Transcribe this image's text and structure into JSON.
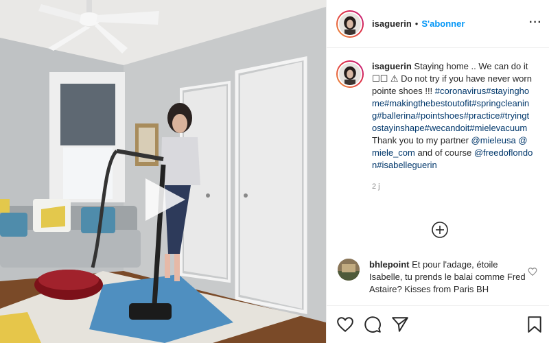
{
  "header": {
    "username": "isaguerin",
    "separator": "•",
    "follow_label": "S'abonner",
    "more_label": "···"
  },
  "caption": {
    "username": "isaguerin",
    "text_intro": " Staying home .. We can do it ☐☐ ⚠ Do not try if you have never worn pointe shoes !!! ",
    "hashtags": "#coronavirus#stayinghome#makingthebestoutofit#springcleaning#ballerina#pointshoes#practice#tryingtostayinshape#wecandoit#mielevacuum",
    "text_after_tags": " Thank you to my partner ",
    "mention_1": "@mieleusa",
    "mention_2": "@miele_com",
    "text_and": " and of course ",
    "mention_3": "@freedoflondon",
    "tag_last": "#isabelleguerin"
  },
  "time_ago": "2 j",
  "comment": {
    "username": "bhlepoint",
    "text": " Et pour l'adage, étoile Isabelle, tu prends le balai comme Fred Astaire? Kisses from Paris BH"
  },
  "icons": {
    "play": "play-icon",
    "load_more": "plus-circle-icon",
    "like": "heart-icon",
    "comment": "comment-icon",
    "share": "paper-plane-icon",
    "save": "bookmark-icon",
    "comment_like": "small-heart-icon",
    "more": "more-icon"
  },
  "colors": {
    "link_blue": "#0095f6",
    "tag_blue": "#00376b",
    "muted": "#8e8e8e",
    "story_ring_start": "#f09433",
    "story_ring_end": "#bc1888"
  }
}
